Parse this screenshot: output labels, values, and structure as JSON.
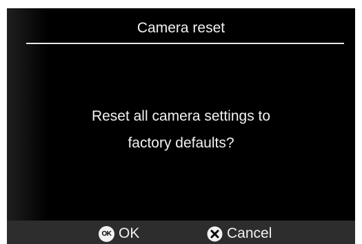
{
  "dialog": {
    "title": "Camera reset",
    "message_line1": "Reset all camera settings to",
    "message_line2": "factory defaults?"
  },
  "footer": {
    "ok_icon_text": "OK",
    "ok_label": "OK",
    "cancel_label": "Cancel",
    "ok_icon": "ok-button-icon",
    "cancel_icon": "x-circle-icon"
  },
  "colors": {
    "background": "#000000",
    "text": "#f2f2f2",
    "footer_bar": "#2d2d2d"
  }
}
